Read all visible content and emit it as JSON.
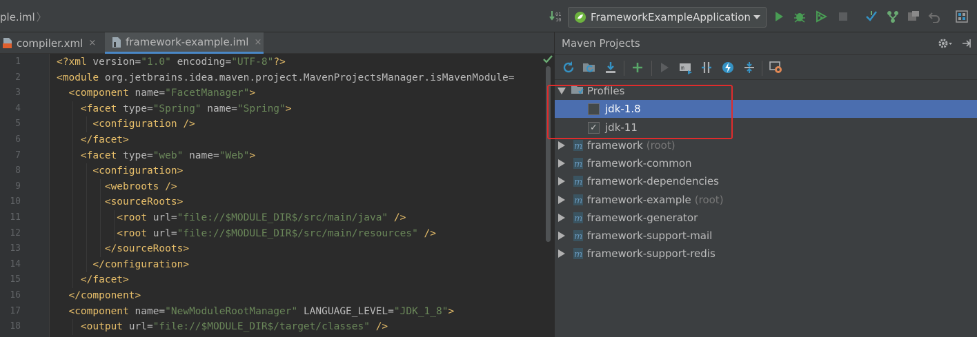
{
  "breadcrumb": {
    "text": "ple.iml"
  },
  "run_config": {
    "label": "FrameworkExampleApplication"
  },
  "tabs": [
    {
      "label": "compiler.xml",
      "close": "×"
    },
    {
      "label": "framework-example.iml",
      "close": "×"
    }
  ],
  "editor": {
    "line_numbers": [
      "1",
      "2",
      "3",
      "4",
      "5",
      "6",
      "7",
      "8",
      "9",
      "10",
      "11",
      "12",
      "13",
      "14",
      "15",
      "16",
      "17",
      "18"
    ],
    "lines": [
      [
        {
          "t": "pi",
          "s": "<?xml "
        },
        {
          "t": "attr",
          "s": "version="
        },
        {
          "t": "val",
          "s": "\"1.0\""
        },
        {
          "t": "attr",
          "s": " encoding="
        },
        {
          "t": "val",
          "s": "\"UTF-8\""
        },
        {
          "t": "pi",
          "s": "?>"
        }
      ],
      [
        {
          "t": "tag",
          "s": "<module "
        },
        {
          "t": "attr",
          "s": "org.jetbrains.idea.maven.project.MavenProjectsManager.isMavenModule="
        }
      ],
      [
        {
          "t": "tag",
          "s": "  <component "
        },
        {
          "t": "attr",
          "s": "name="
        },
        {
          "t": "val",
          "s": "\"FacetManager\""
        },
        {
          "t": "tag",
          "s": ">"
        }
      ],
      [
        {
          "t": "tag",
          "s": "    <facet "
        },
        {
          "t": "attr",
          "s": "type="
        },
        {
          "t": "val",
          "s": "\"Spring\""
        },
        {
          "t": "attr",
          "s": " name="
        },
        {
          "t": "val",
          "s": "\"Spring\""
        },
        {
          "t": "tag",
          "s": ">"
        }
      ],
      [
        {
          "t": "tag",
          "s": "      <configuration />"
        }
      ],
      [
        {
          "t": "tag",
          "s": "    </facet>"
        }
      ],
      [
        {
          "t": "tag",
          "s": "    <facet "
        },
        {
          "t": "attr",
          "s": "type="
        },
        {
          "t": "val",
          "s": "\"web\""
        },
        {
          "t": "attr",
          "s": " name="
        },
        {
          "t": "val",
          "s": "\"Web\""
        },
        {
          "t": "tag",
          "s": ">"
        }
      ],
      [
        {
          "t": "tag",
          "s": "      <configuration>"
        }
      ],
      [
        {
          "t": "tag",
          "s": "        <webroots />"
        }
      ],
      [
        {
          "t": "tag",
          "s": "        <sourceRoots>"
        }
      ],
      [
        {
          "t": "tag",
          "s": "          <root "
        },
        {
          "t": "attr",
          "s": "url="
        },
        {
          "t": "val",
          "s": "\"file://$MODULE_DIR$/src/main/java\""
        },
        {
          "t": "tag",
          "s": " />"
        }
      ],
      [
        {
          "t": "tag",
          "s": "          <root "
        },
        {
          "t": "attr",
          "s": "url="
        },
        {
          "t": "val",
          "s": "\"file://$MODULE_DIR$/src/main/resources\""
        },
        {
          "t": "tag",
          "s": " />"
        }
      ],
      [
        {
          "t": "tag",
          "s": "        </sourceRoots>"
        }
      ],
      [
        {
          "t": "tag",
          "s": "      </configuration>"
        }
      ],
      [
        {
          "t": "tag",
          "s": "    </facet>"
        }
      ],
      [
        {
          "t": "tag",
          "s": "  </component>"
        }
      ],
      [
        {
          "t": "tag",
          "s": "  <component "
        },
        {
          "t": "attr",
          "s": "name="
        },
        {
          "t": "val",
          "s": "\"NewModuleRootManager\""
        },
        {
          "t": "attr",
          "s": " LANGUAGE_LEVEL="
        },
        {
          "t": "val",
          "s": "\"JDK_1_8\""
        },
        {
          "t": "tag",
          "s": ">"
        }
      ],
      [
        {
          "t": "tag",
          "s": "    <output "
        },
        {
          "t": "attr",
          "s": "url="
        },
        {
          "t": "val",
          "s": "\"file://$MODULE_DIR$/target/classes\""
        },
        {
          "t": "tag",
          "s": " />"
        }
      ]
    ]
  },
  "maven": {
    "title": "Maven Projects",
    "profiles_label": "Profiles",
    "profiles": [
      {
        "label": "jdk-1.8",
        "checked": false,
        "selected": true
      },
      {
        "label": "jdk-11",
        "checked": true,
        "selected": false
      }
    ],
    "projects": [
      {
        "label": "framework",
        "suffix": "(root)"
      },
      {
        "label": "framework-common",
        "suffix": ""
      },
      {
        "label": "framework-dependencies",
        "suffix": ""
      },
      {
        "label": "framework-example",
        "suffix": "(root)"
      },
      {
        "label": "framework-generator",
        "suffix": ""
      },
      {
        "label": "framework-support-mail",
        "suffix": ""
      },
      {
        "label": "framework-support-redis",
        "suffix": ""
      }
    ],
    "check_glyph": "✓"
  },
  "colors": {
    "accent": "#4b6eaf",
    "highlight_box": "#e02c2c",
    "run_green": "#499c54"
  },
  "icons": [
    "vcs-update-icon",
    "spring-boot-icon",
    "run-icon",
    "debug-icon",
    "coverage-icon",
    "stop-icon",
    "vcs-commit-icon",
    "vcs-branch-icon",
    "settings-icon",
    "undo-icon",
    "structure-icon",
    "refresh-icon",
    "reimport-icon",
    "download-icon",
    "add-icon",
    "execute-icon",
    "run-goal-icon",
    "toggle-offline-icon",
    "skip-tests-icon",
    "collapse-all-icon",
    "maven-settings-icon",
    "gear-icon",
    "hide-icon",
    "folder-icon",
    "maven-module-icon"
  ]
}
